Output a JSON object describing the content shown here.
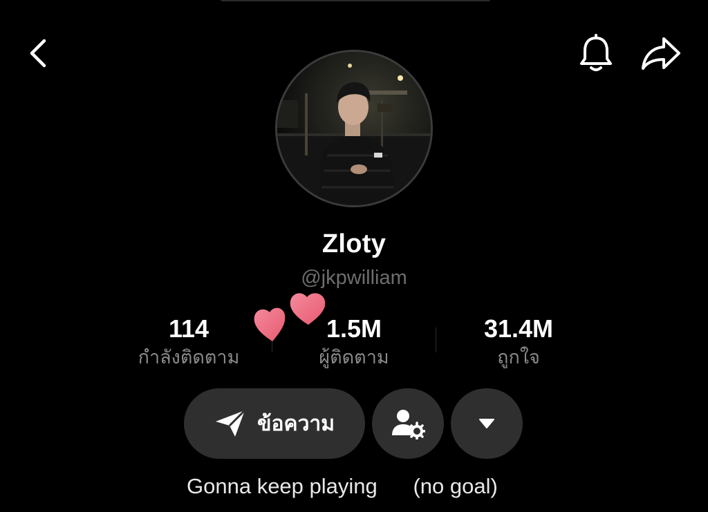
{
  "profile": {
    "display_name": "Zloty",
    "handle": "@jkpwilliam",
    "avatar": "profile-photo"
  },
  "stats": {
    "following": {
      "value": "114",
      "label": "กำลังติดตาม"
    },
    "followers": {
      "value": "1.5M",
      "label": "ผู้ติดตาม"
    },
    "likes": {
      "value": "31.4M",
      "label": "ถูกใจ"
    }
  },
  "actions": {
    "message_label": "ข้อความ",
    "message_icon": "send-icon",
    "friend_settings_icon": "user-settings-icon",
    "more_icon": "caret-down-icon"
  },
  "header": {
    "back_icon": "chevron-left-icon",
    "bell_icon": "bell-icon",
    "share_icon": "share-arrow-icon"
  },
  "bio": {
    "line": "Gonna keep playing      (no goal)"
  },
  "colors": {
    "background": "#000000",
    "button_bg": "#2f2f2f",
    "secondary_text": "#8a8a8a",
    "heart": "#f06b80"
  }
}
